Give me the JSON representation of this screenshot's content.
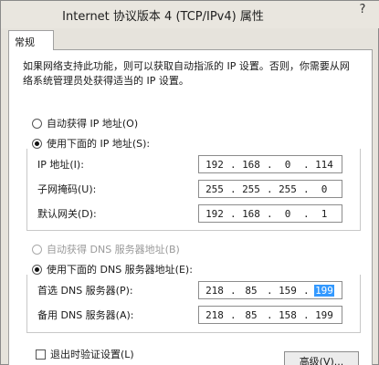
{
  "window": {
    "title": "Internet 协议版本 4 (TCP/IPv4) 属性",
    "help": "?"
  },
  "tabs": [
    {
      "label": "常规"
    }
  ],
  "description_line1": "如果网络支持此功能，则可以获取自动指派的 IP 设置。否则，你需要从网",
  "description_line2": "络系统管理员处获得适当的 IP 设置。",
  "ip": {
    "auto_label": "自动获得 IP 地址(O)",
    "manual_label": "使用下面的 IP 地址(S):",
    "fields": [
      {
        "label": "IP 地址(I):",
        "octets": [
          "192",
          "168",
          "0",
          "114"
        ]
      },
      {
        "label": "子网掩码(U):",
        "octets": [
          "255",
          "255",
          "255",
          "0"
        ]
      },
      {
        "label": "默认网关(D):",
        "octets": [
          "192",
          "168",
          "0",
          "1"
        ]
      }
    ]
  },
  "dns": {
    "auto_label": "自动获得 DNS 服务器地址(B)",
    "manual_label": "使用下面的 DNS 服务器地址(E):",
    "fields": [
      {
        "label": "首选 DNS 服务器(P):",
        "octets": [
          "218",
          "85",
          "159",
          "199"
        ]
      },
      {
        "label": "备用 DNS 服务器(A):",
        "octets": [
          "218",
          "85",
          "158",
          "199"
        ]
      }
    ]
  },
  "validate_label": "退出时验证设置(L)",
  "advanced_label": "高级(V)..."
}
